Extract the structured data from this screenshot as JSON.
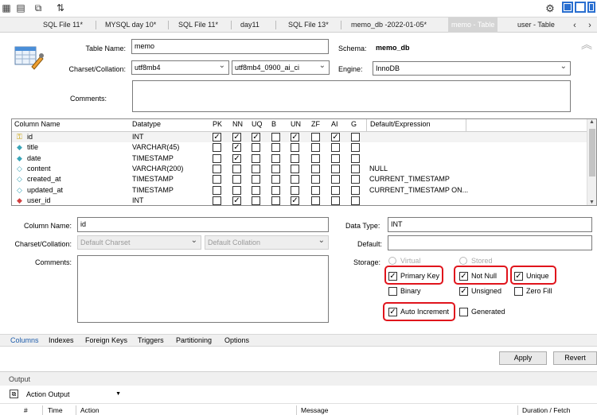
{
  "tabs": [
    "SQL File 11*",
    "MYSQL day 10*",
    "SQL File 11*",
    "day11",
    "SQL File 13*",
    "memo_db -2022-01-05*",
    "memo - Table",
    "user - Table"
  ],
  "form": {
    "table_name_label": "Table Name:",
    "table_name": "memo",
    "schema_label": "Schema:",
    "schema": "memo_db",
    "charset_label": "Charset/Collation:",
    "charset": "utf8mb4",
    "collation": "utf8mb4_0900_ai_ci",
    "engine_label": "Engine:",
    "engine": "InnoDB",
    "comments_label": "Comments:"
  },
  "grid": {
    "headers": {
      "name": "Column Name",
      "datatype": "Datatype",
      "pk": "PK",
      "nn": "NN",
      "uq": "UQ",
      "b": "B",
      "un": "UN",
      "zf": "ZF",
      "ai": "AI",
      "g": "G",
      "default": "Default/Expression"
    },
    "rows": [
      {
        "name": "id",
        "type": "INT",
        "default": "",
        "key": "pk",
        "flags": [
          true,
          true,
          true,
          false,
          true,
          false,
          true,
          false
        ]
      },
      {
        "name": "title",
        "type": "VARCHAR(45)",
        "default": "",
        "key": "nn",
        "flags": [
          false,
          true,
          false,
          false,
          false,
          false,
          false,
          false
        ]
      },
      {
        "name": "date",
        "type": "TIMESTAMP",
        "default": "",
        "key": "nn",
        "flags": [
          false,
          true,
          false,
          false,
          false,
          false,
          false,
          false
        ]
      },
      {
        "name": "content",
        "type": "VARCHAR(200)",
        "default": "NULL",
        "key": "col",
        "flags": [
          false,
          false,
          false,
          false,
          false,
          false,
          false,
          false
        ]
      },
      {
        "name": "created_at",
        "type": "TIMESTAMP",
        "default": "CURRENT_TIMESTAMP",
        "key": "col",
        "flags": [
          false,
          false,
          false,
          false,
          false,
          false,
          false,
          false
        ]
      },
      {
        "name": "updated_at",
        "type": "TIMESTAMP",
        "default": "CURRENT_TIMESTAMP ON...",
        "key": "col",
        "flags": [
          false,
          false,
          false,
          false,
          false,
          false,
          false,
          false
        ]
      },
      {
        "name": "user_id",
        "type": "INT",
        "default": "",
        "key": "fk",
        "flags": [
          false,
          true,
          false,
          false,
          true,
          false,
          false,
          false
        ]
      }
    ]
  },
  "detail": {
    "column_name_label": "Column Name:",
    "column_name": "id",
    "data_type_label": "Data Type:",
    "data_type": "INT",
    "charset_label": "Charset/Collation:",
    "charset_placeholder": "Default Charset",
    "collation_placeholder": "Default Collation",
    "default_label": "Default:",
    "default_value": "",
    "comments_label": "Comments:",
    "storage_label": "Storage:",
    "virtual": "Virtual",
    "stored": "Stored",
    "primary_key": "Primary Key",
    "not_null": "Not Null",
    "unique": "Unique",
    "binary": "Binary",
    "unsigned": "Unsigned",
    "zero_fill": "Zero Fill",
    "auto_increment": "Auto Increment",
    "generated": "Generated"
  },
  "checks": {
    "primary_key": true,
    "not_null": true,
    "unique": true,
    "binary": false,
    "unsigned": true,
    "zero_fill": false,
    "auto_increment": true,
    "generated": false
  },
  "subtabs": [
    "Columns",
    "Indexes",
    "Foreign Keys",
    "Triggers",
    "Partitioning",
    "Options"
  ],
  "buttons": {
    "apply": "Apply",
    "revert": "Revert"
  },
  "output": {
    "title": "Output",
    "selector": "Action Output",
    "columns": [
      "#",
      "Time",
      "Action",
      "Message",
      "Duration / Fetch"
    ]
  },
  "colors": {
    "highlight": "#e0141c",
    "accent": "#2a6fd0"
  }
}
